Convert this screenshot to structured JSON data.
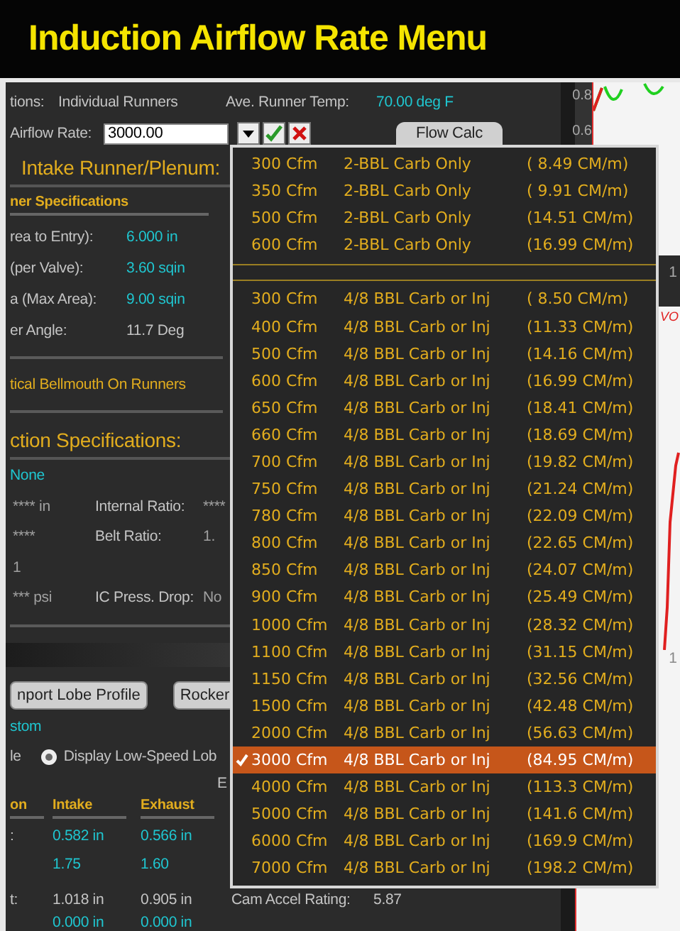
{
  "title": "Induction Airflow Rate Menu",
  "top_row": {
    "config_label": "tions:",
    "config_value": "Individual Runners",
    "temp_label": "Ave. Runner Temp:",
    "temp_value": "70.00 deg F"
  },
  "airflow": {
    "label": "Airflow Rate:",
    "value": "3000.00",
    "flow_calc_button": "Flow Calc"
  },
  "intake_heading": "Intake Runner/Plenum:",
  "runner_spec_heading": "ner Specifications",
  "runner_specs": [
    {
      "label": "rea to Entry):",
      "value": "6.000 in",
      "kind": "input"
    },
    {
      "label": "(per Valve):",
      "value": "3.60 sqin",
      "kind": "input"
    },
    {
      "label": "a (Max Area):",
      "value": "9.00 sqin",
      "kind": "input"
    },
    {
      "label": "er Angle:",
      "value": "11.7 Deg",
      "kind": "calc"
    }
  ],
  "bellmouth": "tical Bellmouth On Runners",
  "induction_heading": "ction Specifications:",
  "induction_type": "None",
  "induction_rows": [
    {
      "value": "**** in",
      "label": "Internal Ratio:",
      "value_2": "****"
    },
    {
      "value": "****",
      "label": "Belt Ratio:",
      "value_2": "1."
    },
    {
      "value": "1",
      "label": "",
      "value_2": ""
    },
    {
      "value": "*** psi",
      "label": "IC Press. Drop:",
      "value_2": "No"
    }
  ],
  "buttons": [
    "nport Lobe Profile",
    "Rocker"
  ],
  "cam_type": "stom",
  "radio_row": {
    "left_label": "le",
    "option": "Display Low-Speed Lob",
    "selected": true
  },
  "side_letter": "E",
  "cam_table": {
    "columns": [
      "on",
      "Intake",
      "Exhaust"
    ],
    "rows": [
      {
        "cells": [
          ":",
          "0.582 in",
          "0.566 in"
        ],
        "kind": "input"
      },
      {
        "cells": [
          "",
          "1.75",
          "1.60"
        ],
        "kind": "input"
      },
      {
        "cells": [
          "t:",
          "1.018 in",
          "0.905 in"
        ],
        "kind": "calc",
        "side_label": "Cam Accel Rating:",
        "side_value": "5.87"
      },
      {
        "cells": [
          "",
          "0.000 in",
          "0.000 in"
        ],
        "kind": "input"
      }
    ]
  },
  "chart_labels": {
    "top_ticks": [
      "0.8",
      "0.6"
    ],
    "mid_tick": "1",
    "legend": "VO",
    "bottom_tick": "1"
  },
  "menu": {
    "groups": [
      {
        "items": [
          {
            "cfm": "300 Cfm",
            "type": "2-BBL Carb Only",
            "rate": "( 8.49 CM/m)",
            "selected": false
          },
          {
            "cfm": "350 Cfm",
            "type": "2-BBL Carb Only",
            "rate": "( 9.91 CM/m)",
            "selected": false
          },
          {
            "cfm": "500 Cfm",
            "type": "2-BBL Carb Only",
            "rate": "(14.51 CM/m)",
            "selected": false
          },
          {
            "cfm": "600 Cfm",
            "type": "2-BBL Carb Only",
            "rate": "(16.99 CM/m)",
            "selected": false
          }
        ]
      },
      {
        "items": [
          {
            "cfm": "300 Cfm",
            "type": "4/8 BBL Carb or Inj",
            "rate": "( 8.50 CM/m)",
            "selected": false
          },
          {
            "cfm": "400 Cfm",
            "type": "4/8 BBL Carb or Inj",
            "rate": "(11.33 CM/m)",
            "selected": false
          },
          {
            "cfm": "500 Cfm",
            "type": "4/8 BBL Carb or Inj",
            "rate": "(14.16 CM/m)",
            "selected": false
          },
          {
            "cfm": "600 Cfm",
            "type": "4/8 BBL Carb or Inj",
            "rate": "(16.99 CM/m)",
            "selected": false
          },
          {
            "cfm": "650 Cfm",
            "type": "4/8 BBL Carb or Inj",
            "rate": "(18.41 CM/m)",
            "selected": false
          },
          {
            "cfm": "660 Cfm",
            "type": "4/8 BBL Carb or Inj",
            "rate": "(18.69 CM/m)",
            "selected": false
          },
          {
            "cfm": "700 Cfm",
            "type": "4/8 BBL Carb or Inj",
            "rate": "(19.82 CM/m)",
            "selected": false
          },
          {
            "cfm": "750 Cfm",
            "type": "4/8 BBL Carb or Inj",
            "rate": "(21.24 CM/m)",
            "selected": false
          },
          {
            "cfm": "780 Cfm",
            "type": "4/8 BBL Carb or Inj",
            "rate": "(22.09 CM/m)",
            "selected": false
          },
          {
            "cfm": "800 Cfm",
            "type": "4/8 BBL Carb or Inj",
            "rate": "(22.65 CM/m)",
            "selected": false
          },
          {
            "cfm": "850 Cfm",
            "type": "4/8 BBL Carb or Inj",
            "rate": "(24.07 CM/m)",
            "selected": false
          },
          {
            "cfm": "900 Cfm",
            "type": "4/8 BBL Carb or Inj",
            "rate": "(25.49 CM/m)",
            "selected": false
          },
          {
            "cfm": "1000 Cfm",
            "type": "4/8 BBL Carb or Inj",
            "rate": "(28.32 CM/m)",
            "selected": false
          },
          {
            "cfm": "1100 Cfm",
            "type": "4/8 BBL Carb or Inj",
            "rate": "(31.15 CM/m)",
            "selected": false
          },
          {
            "cfm": "1150 Cfm",
            "type": "4/8 BBL Carb or Inj",
            "rate": "(32.56 CM/m)",
            "selected": false
          },
          {
            "cfm": "1500 Cfm",
            "type": "4/8 BBL Carb or Inj",
            "rate": "(42.48 CM/m)",
            "selected": false
          },
          {
            "cfm": "2000 Cfm",
            "type": "4/8 BBL Carb or Inj",
            "rate": "(56.63 CM/m)",
            "selected": false
          },
          {
            "cfm": "3000 Cfm",
            "type": "4/8 BBL Carb or Inj",
            "rate": "(84.95 CM/m)",
            "selected": true
          },
          {
            "cfm": "4000 Cfm",
            "type": "4/8 BBL Carb or Inj",
            "rate": "(113.3 CM/m)",
            "selected": false
          },
          {
            "cfm": "5000 Cfm",
            "type": "4/8 BBL Carb or Inj",
            "rate": "(141.6 CM/m)",
            "selected": false
          },
          {
            "cfm": "6000 Cfm",
            "type": "4/8 BBL Carb or Inj",
            "rate": "(169.9 CM/m)",
            "selected": false
          },
          {
            "cfm": "7000 Cfm",
            "type": "4/8 BBL Carb or Inj",
            "rate": "(198.2 CM/m)",
            "selected": false
          }
        ]
      }
    ]
  }
}
